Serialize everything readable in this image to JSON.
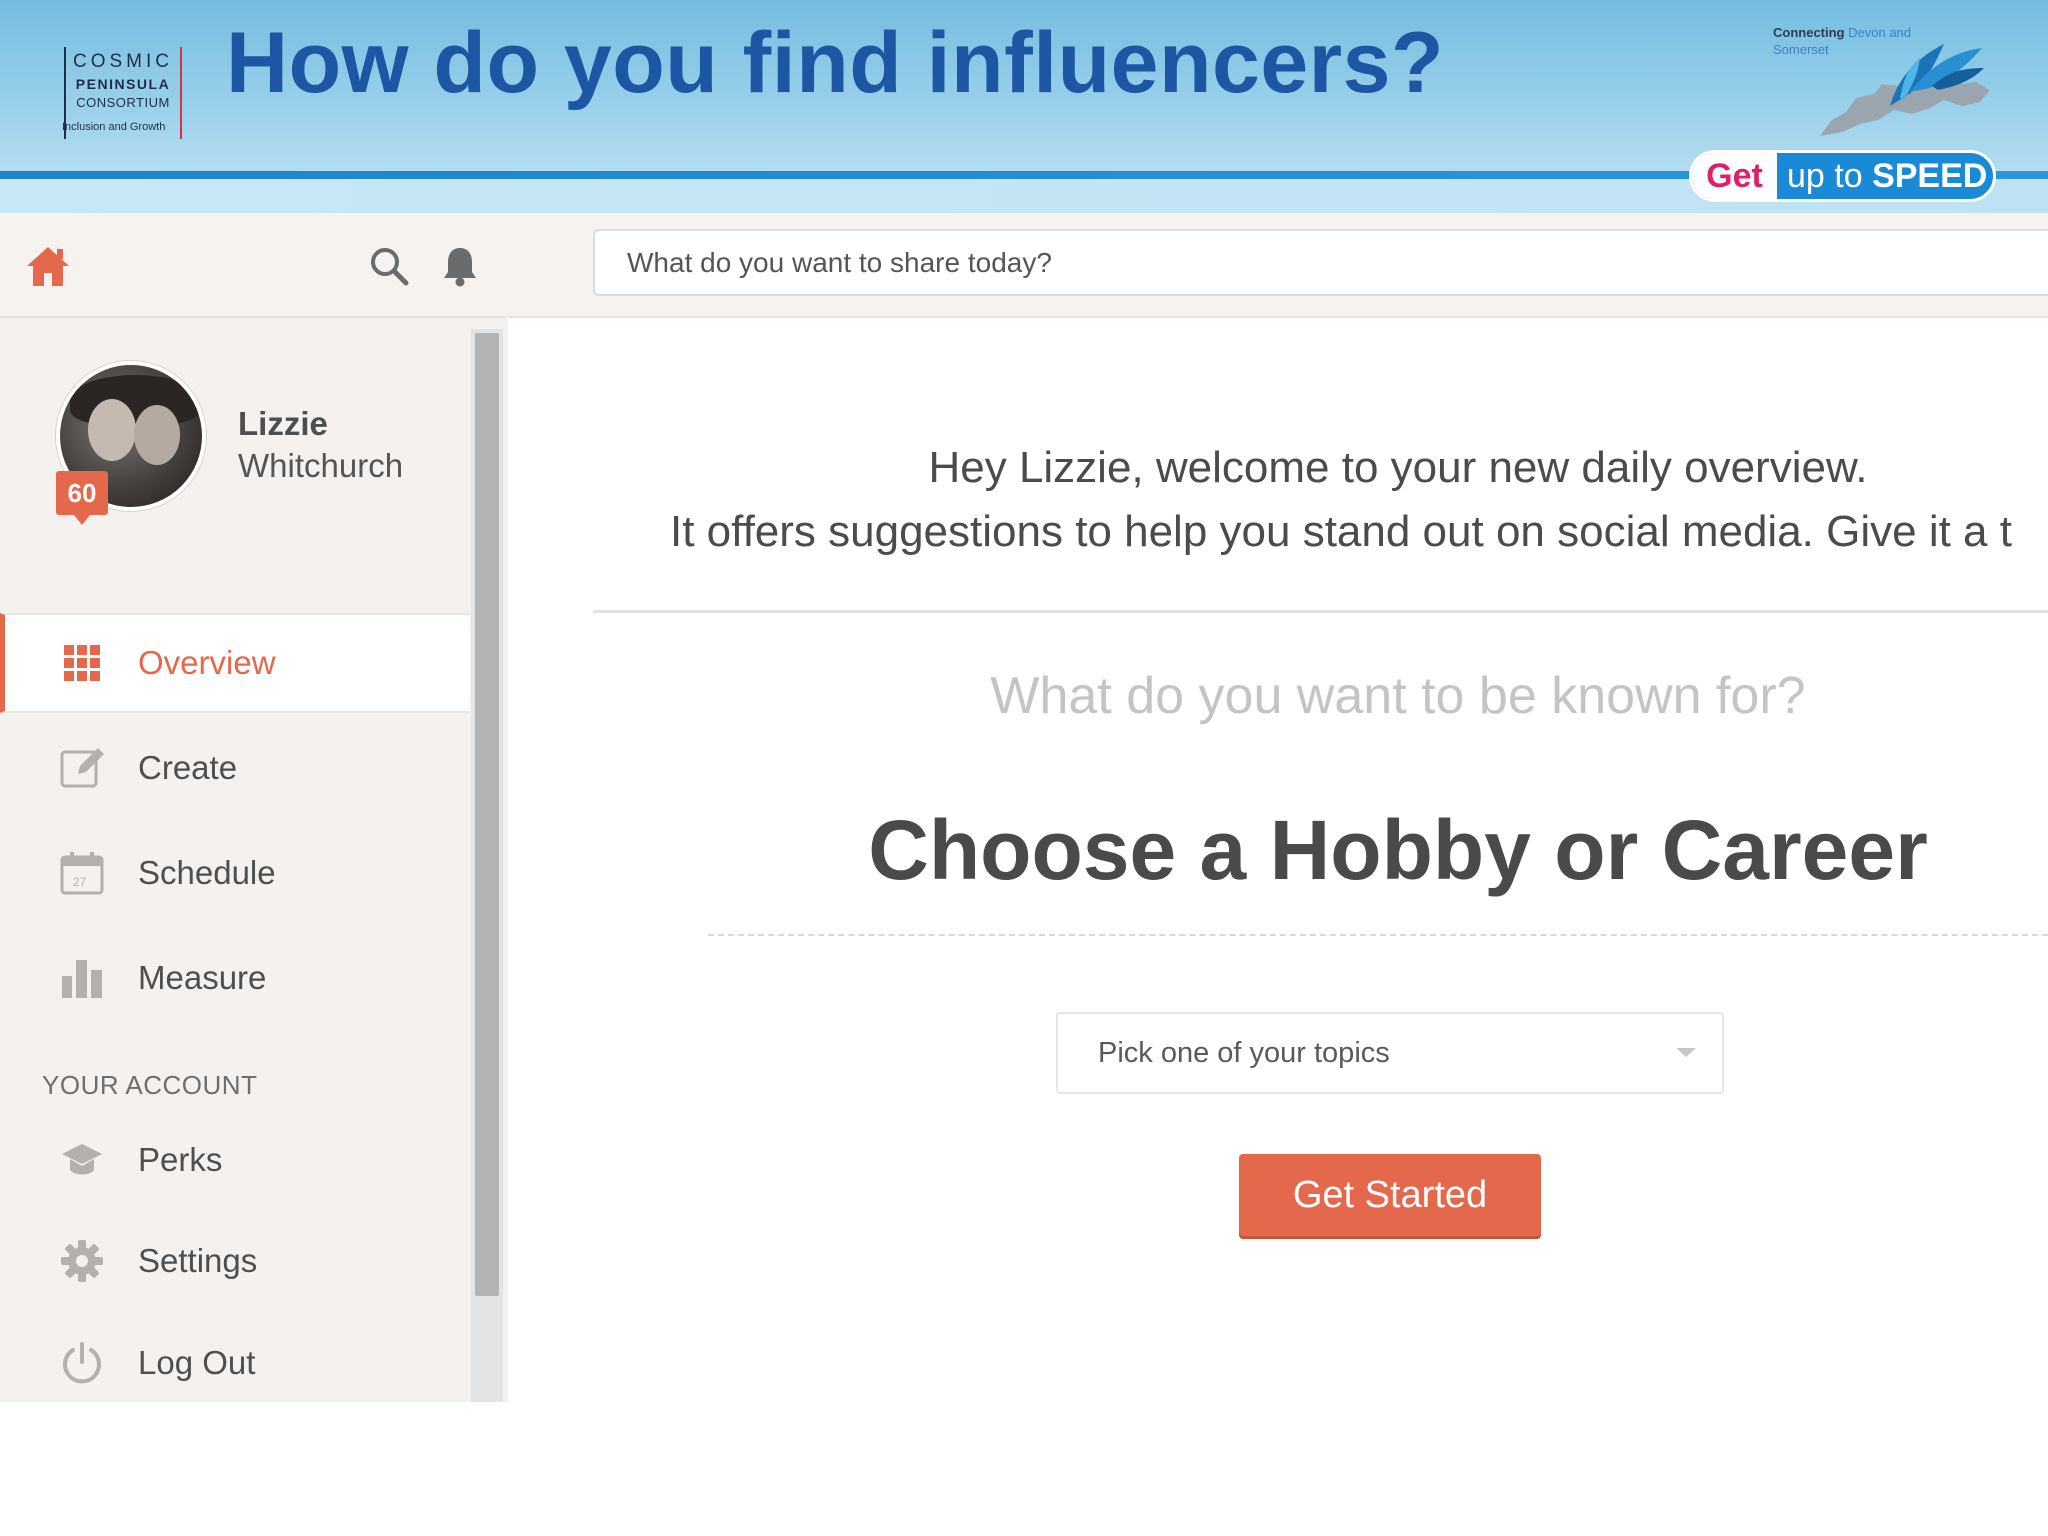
{
  "slide": {
    "title": "How do you find influencers?",
    "logo_left": {
      "line1": "COSMIC",
      "line2": "PENINSULA",
      "line3": "CONSORTIUM",
      "tagline": "Inclusion and Growth"
    },
    "logo_right": {
      "connecting": "Connecting",
      "region": "Devon and Somerset",
      "pill_get": "Get",
      "pill_up_to": "up to",
      "pill_speed": "SPEED"
    }
  },
  "app": {
    "topbar": {
      "share_placeholder": "What do you want to share today?"
    },
    "profile": {
      "first_name": "Lizzie",
      "last_name": "Whitchurch",
      "score": "60"
    },
    "nav": [
      {
        "label": "Overview",
        "icon": "grid-icon",
        "active": true
      },
      {
        "label": "Create",
        "icon": "edit-icon",
        "active": false
      },
      {
        "label": "Schedule",
        "icon": "calendar-icon",
        "active": false
      },
      {
        "label": "Measure",
        "icon": "bar-chart-icon",
        "active": false
      }
    ],
    "account_section_label": "YOUR ACCOUNT",
    "account_nav": [
      {
        "label": "Perks",
        "icon": "graduation-cap-icon"
      },
      {
        "label": "Settings",
        "icon": "gear-icon"
      },
      {
        "label": "Log Out",
        "icon": "power-icon"
      }
    ],
    "main": {
      "welcome_line1": "Hey Lizzie, welcome to your new daily overview.",
      "welcome_line2": "It offers suggestions to help you stand out on social media. Give it a t",
      "known_for": "What do you want to be known for?",
      "choose_title": "Choose a Hobby or Career",
      "topic_select_value": "Pick one of your topics",
      "get_started_label": "Get Started"
    }
  },
  "colors": {
    "accent": "#e4684c",
    "title_blue": "#1d56a3",
    "banner_blue": "#74bde0",
    "sidebar_bg": "#f5f1ee"
  }
}
